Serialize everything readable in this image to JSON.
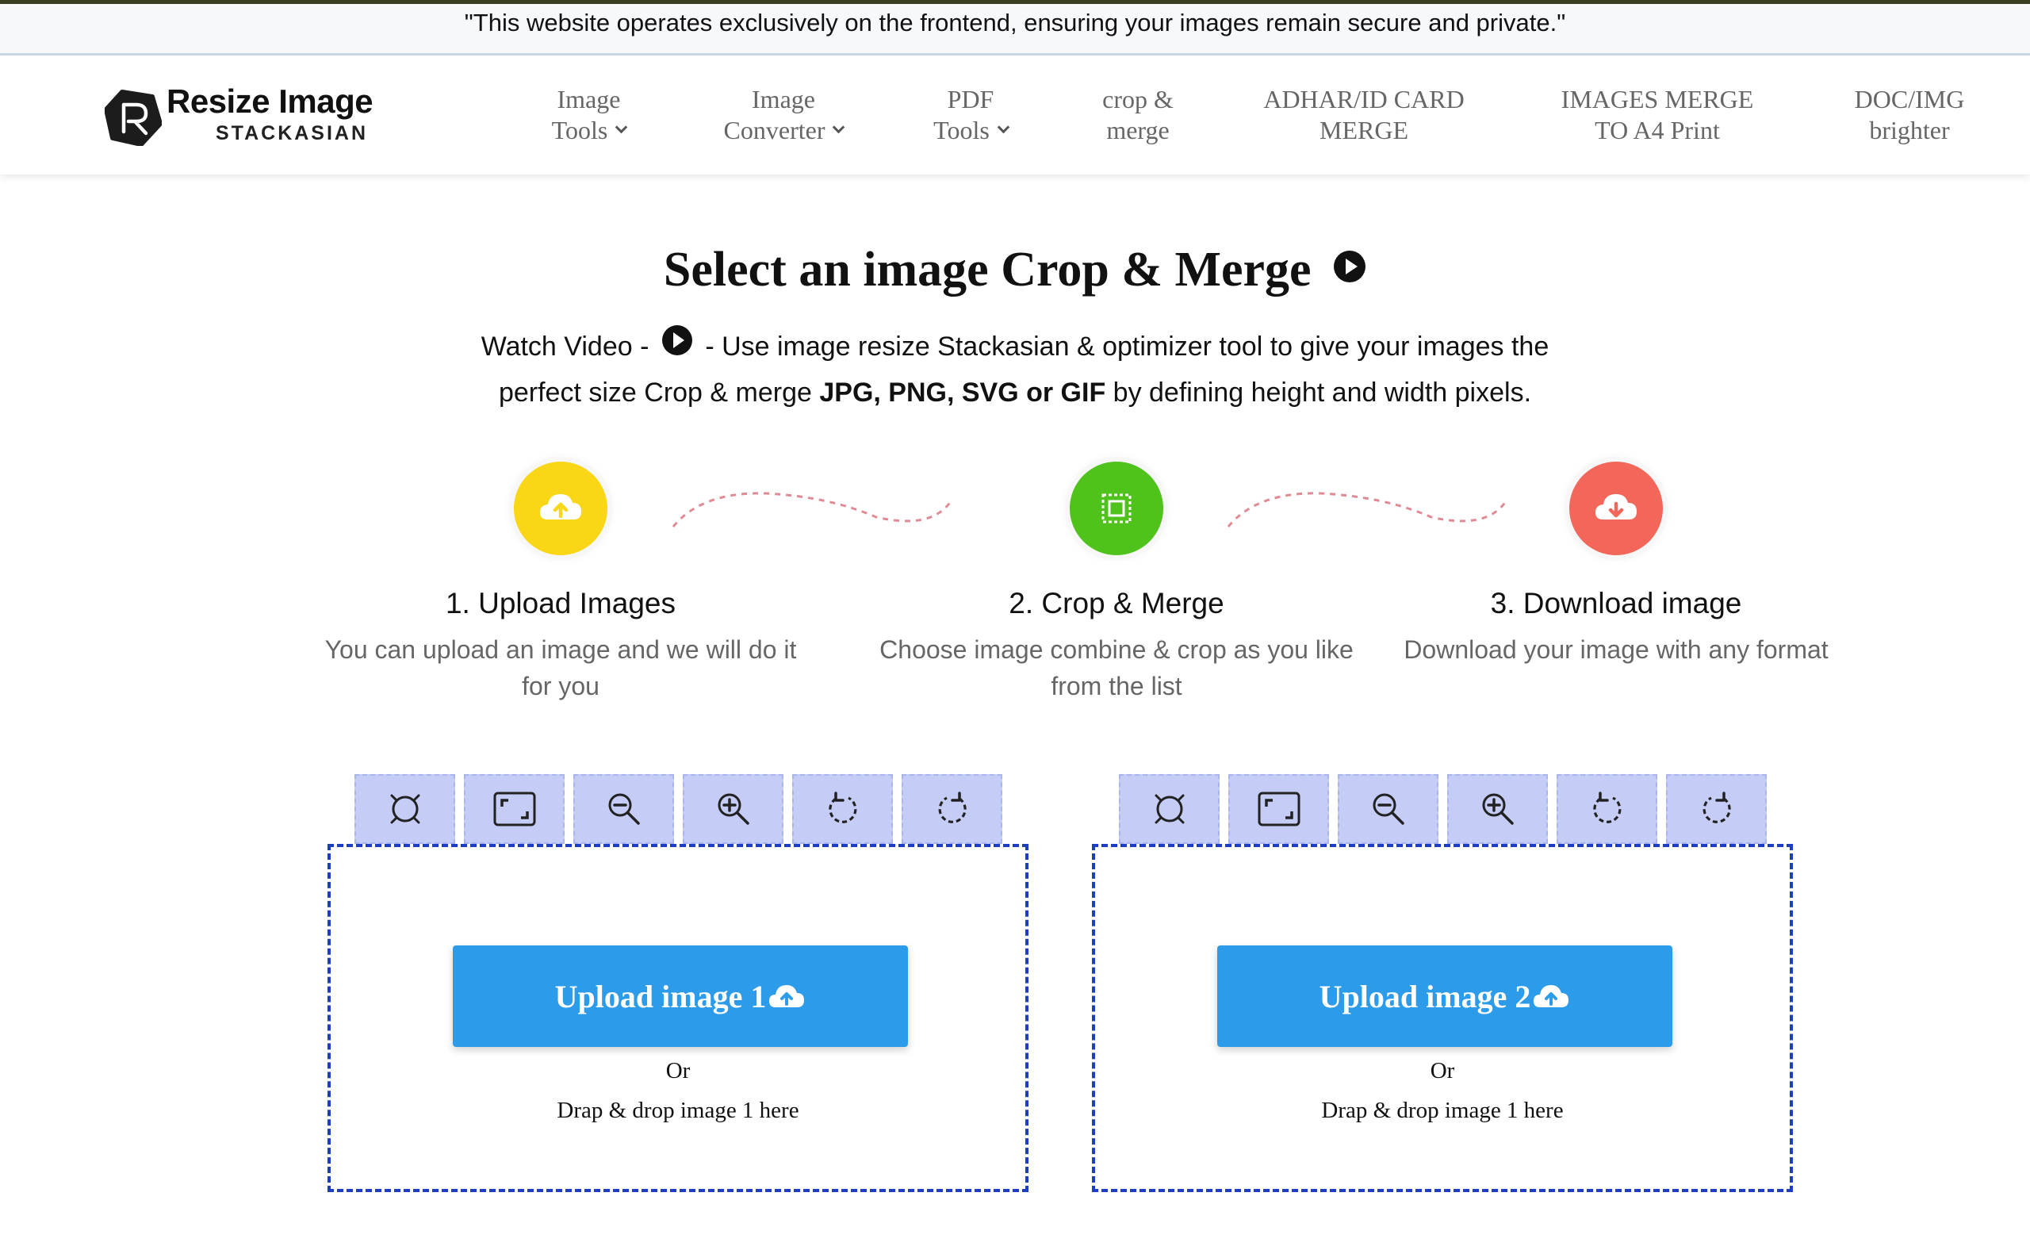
{
  "notice": "\"This website operates exclusively on the frontend, ensuring your images remain secure and private.\"",
  "logo": {
    "title": "Resize Image",
    "subtitle": "STACKASIAN"
  },
  "nav": [
    {
      "line1": "Image",
      "line2": "Tools",
      "dropdown": true
    },
    {
      "line1": "Image",
      "line2": "Converter",
      "dropdown": true
    },
    {
      "line1": "PDF",
      "line2": "Tools",
      "dropdown": true
    },
    {
      "line1": "crop &",
      "line2": "merge",
      "dropdown": false
    },
    {
      "line1": "ADHAR/ID CARD",
      "line2": "MERGE",
      "dropdown": false
    },
    {
      "line1": "IMAGES MERGE",
      "line2": "TO A4 Print",
      "dropdown": false
    },
    {
      "line1": "DOC/IMG",
      "line2": "brighter",
      "dropdown": false
    }
  ],
  "page_title": "Select an image Crop & Merge",
  "subtitle": {
    "watch": "Watch Video -",
    "part1": "- Use image resize Stackasian & optimizer tool to give your images the perfect size Crop & merge",
    "formats": "JPG, PNG, SVG or GIF",
    "part2": "by defining height and width pixels."
  },
  "steps": [
    {
      "title": "1. Upload Images",
      "desc": "You can upload an image and we will do it for you",
      "color": "#f9d616",
      "icon": "cloud-upload-icon"
    },
    {
      "title": "2. Crop & Merge",
      "desc": "Choose image combine & crop as you like from the list",
      "color": "#4fc21b",
      "icon": "crop-merge-icon"
    },
    {
      "title": "3. Download image",
      "desc": "Download your image with any format",
      "color": "#f2675a",
      "icon": "cloud-download-icon"
    }
  ],
  "tools": [
    "reset-icon",
    "fit-icon",
    "zoom-out-icon",
    "zoom-in-icon",
    "rotate-left-icon",
    "rotate-right-icon"
  ],
  "panels": [
    {
      "button": "Upload image 1",
      "or": "Or",
      "drop": "Drap & drop image 1 here"
    },
    {
      "button": "Upload image 2",
      "or": "Or",
      "drop": "Drap & drop image 1 here"
    }
  ],
  "colors": {
    "upload_button": "#2c9be9",
    "toolbar": "#c5cdf7",
    "dropzone_border": "#1b3fc0"
  }
}
